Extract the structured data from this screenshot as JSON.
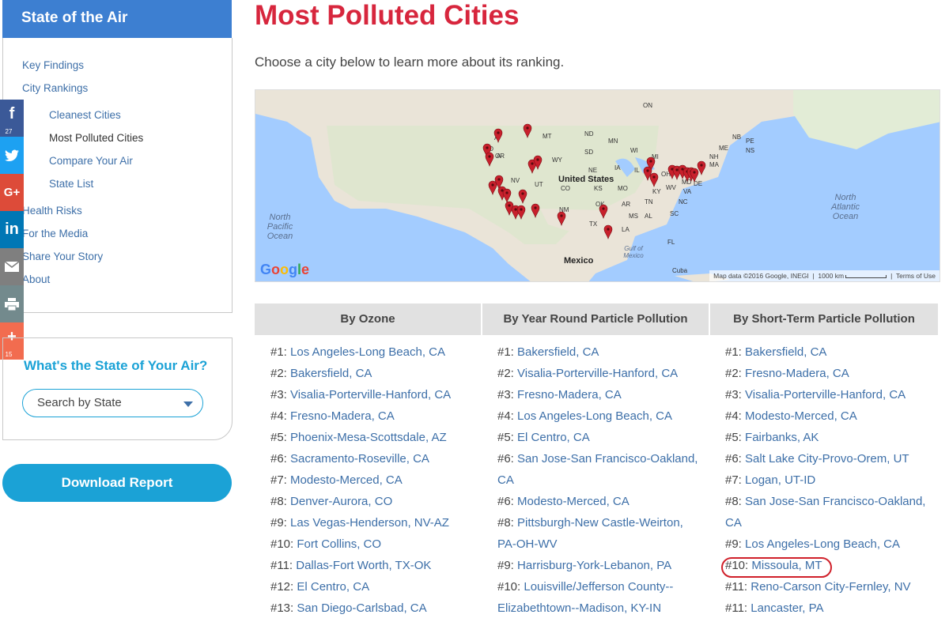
{
  "sidebar": {
    "title": "State of the Air",
    "items": [
      {
        "label": "Key Findings"
      },
      {
        "label": "City Rankings"
      },
      {
        "label": "Cleanest Cities"
      },
      {
        "label": "Most Polluted Cities"
      },
      {
        "label": "Compare Your Air"
      },
      {
        "label": "State List"
      },
      {
        "label": "Health Risks"
      },
      {
        "label": "For the Media"
      },
      {
        "label": "Share Your Story"
      },
      {
        "label": "About"
      }
    ]
  },
  "share": {
    "facebook_count": "27",
    "plus_count": "15",
    "colors": {
      "facebook": "#3b5998",
      "twitter": "#1da1f2",
      "googleplus": "#dd4b39",
      "linkedin": "#0077b5",
      "email": "#7f7f7f",
      "print": "#738a8d",
      "plus": "#f26c4f"
    }
  },
  "state_box": {
    "title": "What's the State of Your Air?",
    "select_value": "Search by State"
  },
  "download": {
    "label": "Download Report"
  },
  "main": {
    "title": "Most Polluted Cities",
    "intro": "Choose a city below to learn more about its ranking."
  },
  "map": {
    "labels": {
      "on": "ON",
      "mt": "MT",
      "nd": "ND",
      "mn": "MN",
      "sd": "SD",
      "wy": "WY",
      "wi": "WI",
      "mi": "MI",
      "nv": "NV",
      "ut": "UT",
      "ne": "NE",
      "ia": "IA",
      "co": "CO",
      "ks": "KS",
      "mo": "MO",
      "ky": "KY",
      "wv": "WV",
      "va": "VA",
      "nm": "NM",
      "ok": "OK",
      "ar": "AR",
      "tn": "TN",
      "nc": "NC",
      "ms": "MS",
      "al": "AL",
      "sc": "SC",
      "tx": "TX",
      "la": "LA",
      "fl": "FL",
      "pe": "PE",
      "nb": "NB",
      "ns": "NS",
      "me": "ME",
      "nh": "NH",
      "ma": "MA",
      "oh": "OH",
      "md": "MD",
      "de": "DE",
      "il": "IL",
      "or": "OR",
      "id": "ID",
      "a": "A"
    },
    "country": "United States",
    "mexico": "Mexico",
    "gulf": "Gulf of Mexico",
    "cuba": "Cuba",
    "north_pacific": "North Pacific Ocean",
    "north_atlantic": "North Atlantic Ocean",
    "google": "Google",
    "attribution": "Map data ©2016 Google, INEGI",
    "scale": "1000 km",
    "terms": "Terms of Use",
    "pin_color": "#c8202c"
  },
  "columns": [
    {
      "heading": "By Ozone"
    },
    {
      "heading": "By Year Round Particle Pollution"
    },
    {
      "heading": "By Short-Term Particle Pollution"
    }
  ],
  "rankings": {
    "ozone": [
      {
        "rank": "#1:",
        "city": "Los Angeles-Long Beach, CA"
      },
      {
        "rank": "#2:",
        "city": "Bakersfield, CA"
      },
      {
        "rank": "#3:",
        "city": "Visalia-Porterville-Hanford, CA"
      },
      {
        "rank": "#4:",
        "city": "Fresno-Madera, CA"
      },
      {
        "rank": "#5:",
        "city": "Phoenix-Mesa-Scottsdale, AZ"
      },
      {
        "rank": "#6:",
        "city": "Sacramento-Roseville, CA"
      },
      {
        "rank": "#7:",
        "city": "Modesto-Merced, CA"
      },
      {
        "rank": "#8:",
        "city": "Denver-Aurora, CO"
      },
      {
        "rank": "#9:",
        "city": "Las Vegas-Henderson, NV-AZ"
      },
      {
        "rank": "#10:",
        "city": "Fort Collins, CO"
      },
      {
        "rank": "#11:",
        "city": "Dallas-Fort Worth, TX-OK"
      },
      {
        "rank": "#12:",
        "city": "El Centro, CA"
      },
      {
        "rank": "#13:",
        "city": "San Diego-Carlsbad, CA"
      }
    ],
    "year_round": [
      {
        "rank": "#1:",
        "city": "Bakersfield, CA"
      },
      {
        "rank": "#2:",
        "city": "Visalia-Porterville-Hanford, CA"
      },
      {
        "rank": "#3:",
        "city": "Fresno-Madera, CA"
      },
      {
        "rank": "#4:",
        "city": "Los Angeles-Long Beach, CA"
      },
      {
        "rank": "#5:",
        "city": "El Centro, CA"
      },
      {
        "rank": "#6:",
        "city": "San Jose-San Francisco-Oakland,",
        "cont": "CA"
      },
      {
        "rank": "#6:",
        "city": "Modesto-Merced, CA"
      },
      {
        "rank": "#8:",
        "city": "Pittsburgh-New Castle-Weirton,",
        "cont": "PA-OH-WV"
      },
      {
        "rank": "#9:",
        "city": "Harrisburg-York-Lebanon, PA"
      },
      {
        "rank": "#10:",
        "city": "Louisville/Jefferson County--",
        "cont": "Elizabethtown--Madison, KY-IN"
      }
    ],
    "short_term": [
      {
        "rank": "#1:",
        "city": "Bakersfield, CA"
      },
      {
        "rank": "#2:",
        "city": "Fresno-Madera, CA"
      },
      {
        "rank": "#3:",
        "city": "Visalia-Porterville-Hanford, CA"
      },
      {
        "rank": "#4:",
        "city": "Modesto-Merced, CA"
      },
      {
        "rank": "#5:",
        "city": "Fairbanks, AK"
      },
      {
        "rank": "#6:",
        "city": "Salt Lake City-Provo-Orem, UT"
      },
      {
        "rank": "#7:",
        "city": "Logan, UT-ID"
      },
      {
        "rank": "#8:",
        "city": "San Jose-San Francisco-Oakland,",
        "cont": "CA"
      },
      {
        "rank": "#9:",
        "city": "Los Angeles-Long Beach, CA"
      },
      {
        "rank": "#10:",
        "city": "Missoula, MT"
      },
      {
        "rank": "#11:",
        "city": "Reno-Carson City-Fernley, NV"
      },
      {
        "rank": "#11:",
        "city": "Lancaster, PA"
      }
    ]
  }
}
